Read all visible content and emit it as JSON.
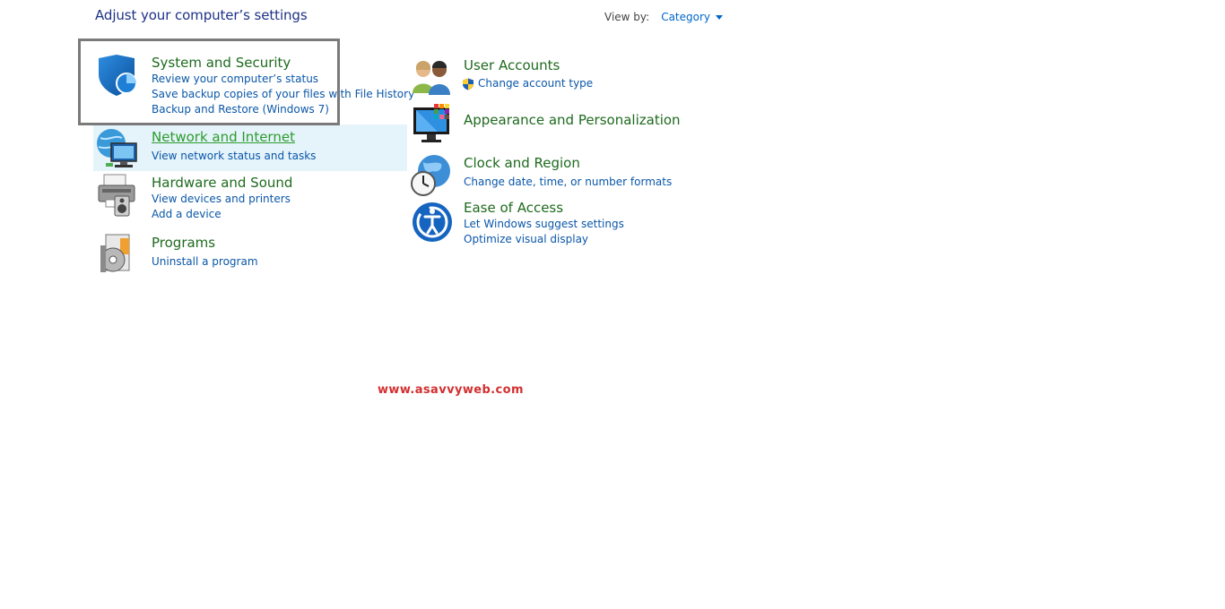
{
  "header": {
    "title": "Adjust your computer’s settings",
    "view_by_label": "View by:",
    "view_by_value": "Category"
  },
  "categories": [
    {
      "title": "System and Security",
      "links": [
        "Review your computer’s status",
        "Save backup copies of your files with File History",
        "Backup and Restore (Windows 7)"
      ],
      "icon": "shield-icon"
    },
    {
      "title": "Network and Internet",
      "links": [
        "View network status and tasks"
      ],
      "icon": "network-globe-icon"
    },
    {
      "title": "Hardware and Sound",
      "links": [
        "View devices and printers",
        "Add a device"
      ],
      "icon": "printer-speaker-icon"
    },
    {
      "title": "Programs",
      "links": [
        "Uninstall a program"
      ],
      "icon": "programs-disc-icon"
    },
    {
      "title": "User Accounts",
      "links": [
        "Change account type"
      ],
      "icon": "users-icon"
    },
    {
      "title": "Appearance and Personalization",
      "links": [],
      "icon": "monitor-palette-icon"
    },
    {
      "title": "Clock and Region",
      "links": [
        "Change date, time, or number formats"
      ],
      "icon": "globe-clock-icon"
    },
    {
      "title": "Ease of Access",
      "links": [
        "Let Windows suggest settings",
        "Optimize visual display"
      ],
      "icon": "ease-of-access-icon"
    }
  ],
  "watermark": "www.asavvyweb.com",
  "colors": {
    "category_title": "#1e6a1e",
    "link": "#0a57a8",
    "page_title": "#1e3287",
    "hover_background": "#e5f3fb",
    "watermark": "#d32f2f"
  }
}
